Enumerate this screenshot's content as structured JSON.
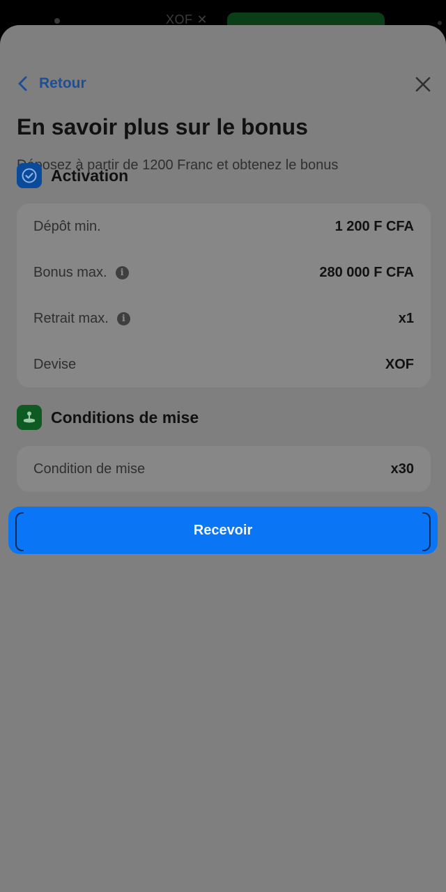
{
  "background": {
    "currency_label": "XOF",
    "currency_chevron": "✕"
  },
  "header": {
    "back_label": "Retour",
    "back_icon": "chevron-left-icon",
    "close_icon": "close-icon"
  },
  "content": {
    "title": "En savoir plus sur le bonus",
    "subtitle": "Déposez à partir de 1200 Franc et obtenez le bonus"
  },
  "activation": {
    "title": "Activation",
    "icon": "check-circle-icon",
    "rows": [
      {
        "label": "Dépôt min.",
        "value": "1 200 F CFA",
        "info": false
      },
      {
        "label": "Bonus max.",
        "value": "280 000 F CFA",
        "info": true
      },
      {
        "label": "Retrait max.",
        "value": "x1",
        "info": true
      },
      {
        "label": "Devise",
        "value": "XOF",
        "info": false
      }
    ]
  },
  "wagering": {
    "title": "Conditions de mise",
    "icon": "joystick-icon",
    "rows": [
      {
        "label": "Condition de mise",
        "value": "x30"
      }
    ]
  },
  "cta": {
    "label": "Recevoir"
  },
  "colors": {
    "accent": "#0a75f5",
    "overlay": "#7f7f7f",
    "link": "#1e4f95",
    "green_badge": "#0e5a22",
    "blue_badge": "#0a4a9a"
  }
}
